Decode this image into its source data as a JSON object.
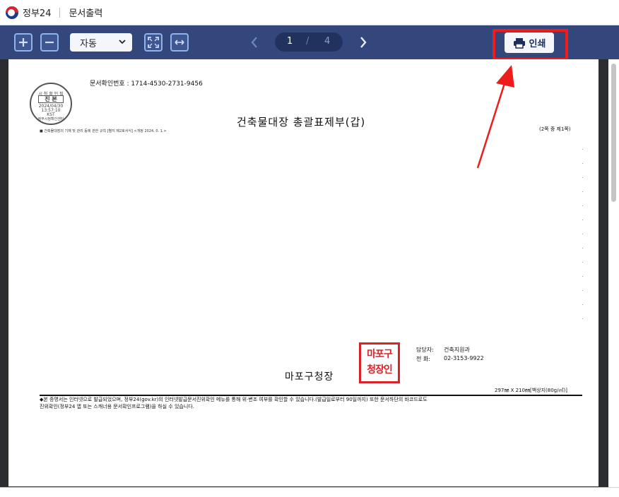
{
  "titlebar": {
    "site_name": "정부24",
    "window_title": "문서출력"
  },
  "toolbar": {
    "zoom_value": "자동",
    "page_current": "1",
    "page_separator": "/",
    "page_total": "4",
    "print_label": "인쇄"
  },
  "document": {
    "verification_number": "문서확인번호 : 1714-4530-2731-9456",
    "title": "건축물대장 총괄표제부(갑)",
    "small_note": "■ 건축물대장의 기재 및 관리 등에 관한 규칙 [별지 제2호서식] <개정 2024. 0. 1.>",
    "page_info": "(2쪽 중 제1쪽)",
    "issuer": "마포구청장",
    "contact_person_label": "담당자:",
    "contact_person": "건축지원과",
    "contact_phone_label": "전    화:",
    "contact_phone": "02-3153-9922",
    "paper_spec": "297㎜ X 210㎜[백상지(80g/㎡)]",
    "notice_line1": "◆본 증명서는 인터넷으로 발급되었으며, 정부24(gov.kr)의 인터넷발급문서진위확인 메뉴를 통해 위·변조 여부를 확인할 수 있습니다.(발급일로부터 90일까지) 또한 문서하단의 바코드로도",
    "notice_line2": "진위확인(정부24 앱 또는 스캐너용 문서확인프로그램)을 하실 수 있습니다.",
    "seal_stamp": {
      "top": "시 청 확 인 필",
      "main": "진 본",
      "date": "2024/04/30",
      "time": "13:57:10",
      "tz": "KST",
      "bottom": "정부시청확인센터"
    },
    "red_seal": {
      "line1": "마포구",
      "line2": "청장인"
    }
  },
  "colors": {
    "toolbar_bg": "#33477d",
    "highlight": "#ef1c1c",
    "viewport_bg": "#2b2d31",
    "seal_red": "#d8232a"
  },
  "icons": [
    "zoom-in-icon",
    "zoom-out-icon",
    "fit-page-icon",
    "fit-width-icon",
    "prev-page-icon",
    "next-page-icon",
    "printer-icon",
    "chevron-down-icon"
  ]
}
